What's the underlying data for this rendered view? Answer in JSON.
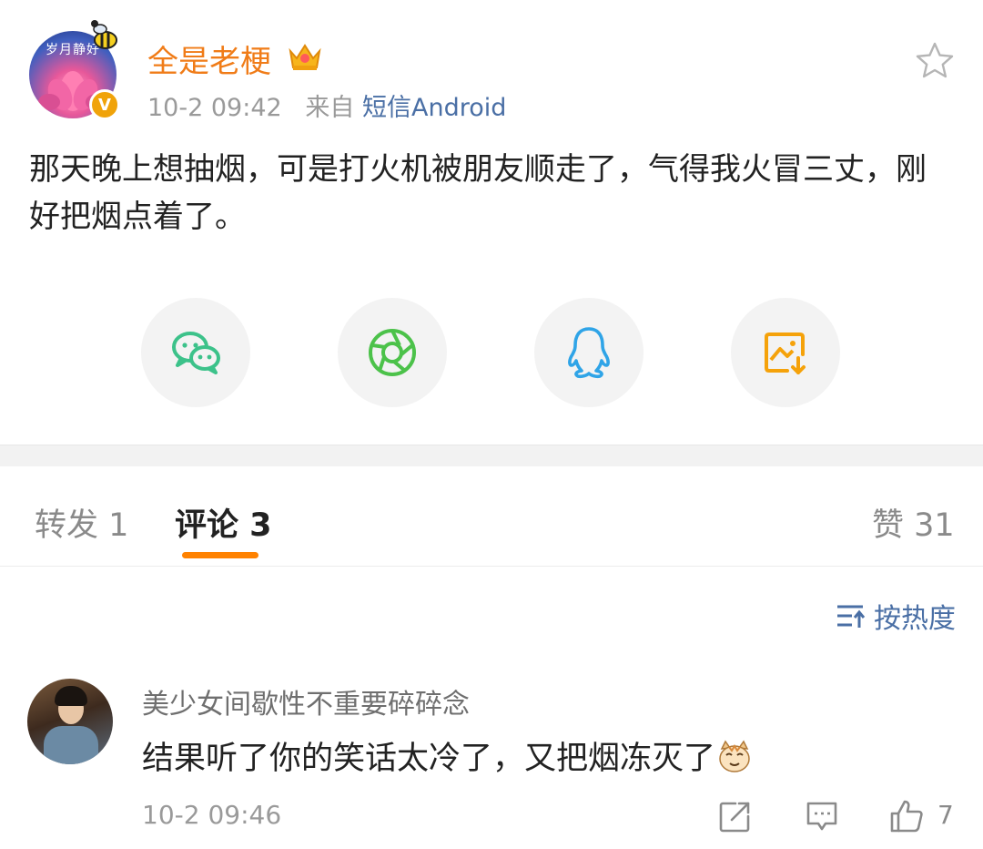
{
  "post": {
    "avatar_caption": "岁月静好",
    "verified_mark": "V",
    "username": "全是老梗",
    "time": "10-2 09:42",
    "source_prefix": "来自",
    "source": "短信Android",
    "text": "那天晚上想抽烟，可是打火机被朋友顺走了，气得我火冒三丈，刚好把烟点着了。"
  },
  "share": [
    {
      "name": "wechat-icon",
      "color": "#3cc28a"
    },
    {
      "name": "moments-icon",
      "color": "#4cc24a"
    },
    {
      "name": "qq-icon",
      "color": "#2fa4e7"
    },
    {
      "name": "save-image-icon",
      "color": "#f5a20a"
    }
  ],
  "tabs": {
    "repost": "转发 1",
    "comments": "评论 3",
    "likes": "赞 31"
  },
  "sort": {
    "label": "按热度"
  },
  "comment": {
    "name": "美少女间歇性不重要碎碎念",
    "text": "结果听了你的笑话太冷了，又把烟冻灭了",
    "time": "10-2 09:46",
    "like_count": "7"
  },
  "colors": {
    "accent": "#ff8200",
    "username": "#f07c18",
    "link": "#4a6fa5"
  }
}
